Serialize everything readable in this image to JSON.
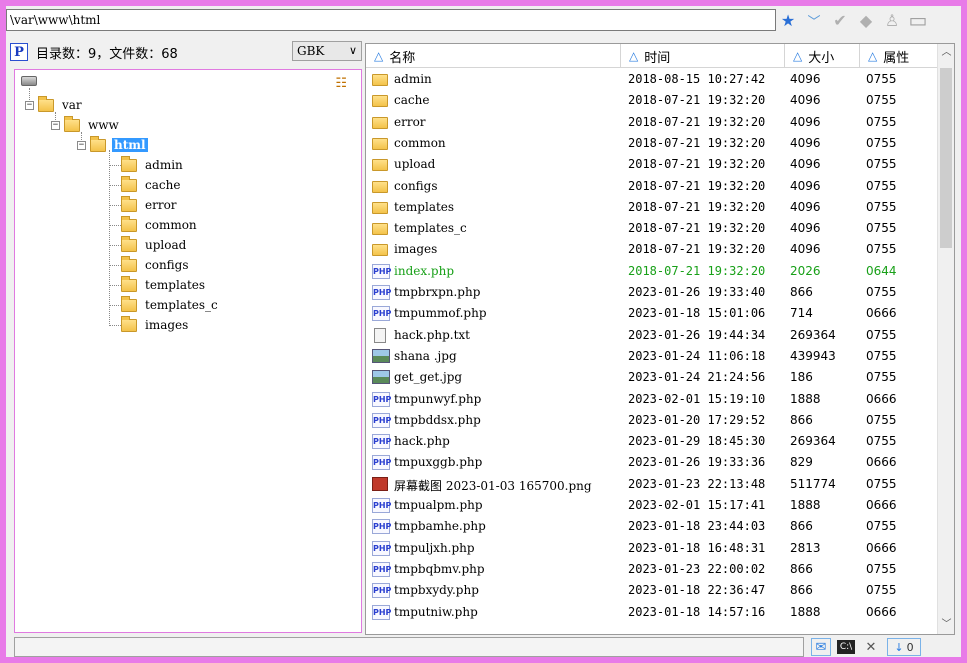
{
  "address": {
    "path": "\\var\\www\\html"
  },
  "toolbar": {
    "icons": [
      "star-icon",
      "dropdown-check-icon",
      "check-icon",
      "back-icon",
      "user-icon",
      "window-icon"
    ],
    "glyphs": {
      "star": "★",
      "drop": "﹀",
      "check": "✔",
      "back": "◆",
      "user": "♙",
      "window": "▭"
    }
  },
  "left_header": {
    "p_label": "P",
    "count_text": "目录数：9，文件数：68",
    "encoding": "GBK",
    "encoding_chev": "∨"
  },
  "tree": {
    "root": "var",
    "level1": "www",
    "selected": "html",
    "children": [
      "admin",
      "cache",
      "error",
      "common",
      "upload",
      "configs",
      "templates",
      "templates_c",
      "images"
    ],
    "expander_glyph": "−"
  },
  "list": {
    "headers": {
      "name": "名称",
      "time": "时间",
      "size": "大小",
      "attr": "属性"
    },
    "sort_glyph": "△",
    "files": [
      {
        "icon": "folder",
        "name": "admin",
        "time": "2018-08-15 10:27:42",
        "size": "4096",
        "attr": "0755"
      },
      {
        "icon": "folder",
        "name": "cache",
        "time": "2018-07-21 19:32:20",
        "size": "4096",
        "attr": "0755"
      },
      {
        "icon": "folder",
        "name": "error",
        "time": "2018-07-21 19:32:20",
        "size": "4096",
        "attr": "0755"
      },
      {
        "icon": "folder",
        "name": "common",
        "time": "2018-07-21 19:32:20",
        "size": "4096",
        "attr": "0755"
      },
      {
        "icon": "folder",
        "name": "upload",
        "time": "2018-07-21 19:32:20",
        "size": "4096",
        "attr": "0755"
      },
      {
        "icon": "folder",
        "name": "configs",
        "time": "2018-07-21 19:32:20",
        "size": "4096",
        "attr": "0755"
      },
      {
        "icon": "folder",
        "name": "templates",
        "time": "2018-07-21 19:32:20",
        "size": "4096",
        "attr": "0755"
      },
      {
        "icon": "folder",
        "name": "templates_c",
        "time": "2018-07-21 19:32:20",
        "size": "4096",
        "attr": "0755"
      },
      {
        "icon": "folder",
        "name": "images",
        "time": "2018-07-21 19:32:20",
        "size": "4096",
        "attr": "0755"
      },
      {
        "icon": "php",
        "name": "index.php",
        "time": "2018-07-21 19:32:20",
        "size": "2026",
        "attr": "0644",
        "highlight": true
      },
      {
        "icon": "php",
        "name": "tmpbrxpn.php",
        "time": "2023-01-26 19:33:40",
        "size": "866",
        "attr": "0755"
      },
      {
        "icon": "php",
        "name": "tmpummof.php",
        "time": "2023-01-18 15:01:06",
        "size": "714",
        "attr": "0666"
      },
      {
        "icon": "txt",
        "name": "hack.php.txt",
        "time": "2023-01-26 19:44:34",
        "size": "269364",
        "attr": "0755"
      },
      {
        "icon": "img",
        "name": "shana .jpg",
        "time": "2023-01-24 11:06:18",
        "size": "439943",
        "attr": "0755"
      },
      {
        "icon": "img",
        "name": "get_get.jpg",
        "time": "2023-01-24 21:24:56",
        "size": "186",
        "attr": "0755"
      },
      {
        "icon": "php",
        "name": "tmpunwyf.php",
        "time": "2023-02-01 15:19:10",
        "size": "1888",
        "attr": "0666"
      },
      {
        "icon": "php",
        "name": "tmpbddsx.php",
        "time": "2023-01-20 17:29:52",
        "size": "866",
        "attr": "0755"
      },
      {
        "icon": "php",
        "name": "hack.php",
        "time": "2023-01-29 18:45:30",
        "size": "269364",
        "attr": "0755"
      },
      {
        "icon": "php",
        "name": "tmpuxggb.php",
        "time": "2023-01-26 19:33:36",
        "size": "829",
        "attr": "0666"
      },
      {
        "icon": "png",
        "name": "屏幕截图 2023-01-03 165700.png",
        "time": "2023-01-23 22:13:48",
        "size": "511774",
        "attr": "0755"
      },
      {
        "icon": "php",
        "name": "tmpualpm.php",
        "time": "2023-02-01 15:17:41",
        "size": "1888",
        "attr": "0666"
      },
      {
        "icon": "php",
        "name": "tmpbamhe.php",
        "time": "2023-01-18 23:44:03",
        "size": "866",
        "attr": "0755"
      },
      {
        "icon": "php",
        "name": "tmpuljxh.php",
        "time": "2023-01-18 16:48:31",
        "size": "2813",
        "attr": "0666"
      },
      {
        "icon": "php",
        "name": "tmpbqbmv.php",
        "time": "2023-01-23 22:00:02",
        "size": "866",
        "attr": "0755"
      },
      {
        "icon": "php",
        "name": "tmpbxydy.php",
        "time": "2023-01-18 22:36:47",
        "size": "866",
        "attr": "0755"
      },
      {
        "icon": "php",
        "name": "tmputniw.php",
        "time": "2023-01-18 14:57:16",
        "size": "1888",
        "attr": "0666"
      }
    ]
  },
  "status": {
    "download_count": "0",
    "icons": [
      "mail-icon",
      "console-icon",
      "tools-icon",
      "download-icon"
    ],
    "glyphs": {
      "mail": "✉",
      "console": "▪",
      "tools": "✕",
      "download": "↓"
    }
  },
  "colors": {
    "accent": "#3399ff",
    "highlight_row": "#18a018",
    "frame": "#e87be8"
  }
}
